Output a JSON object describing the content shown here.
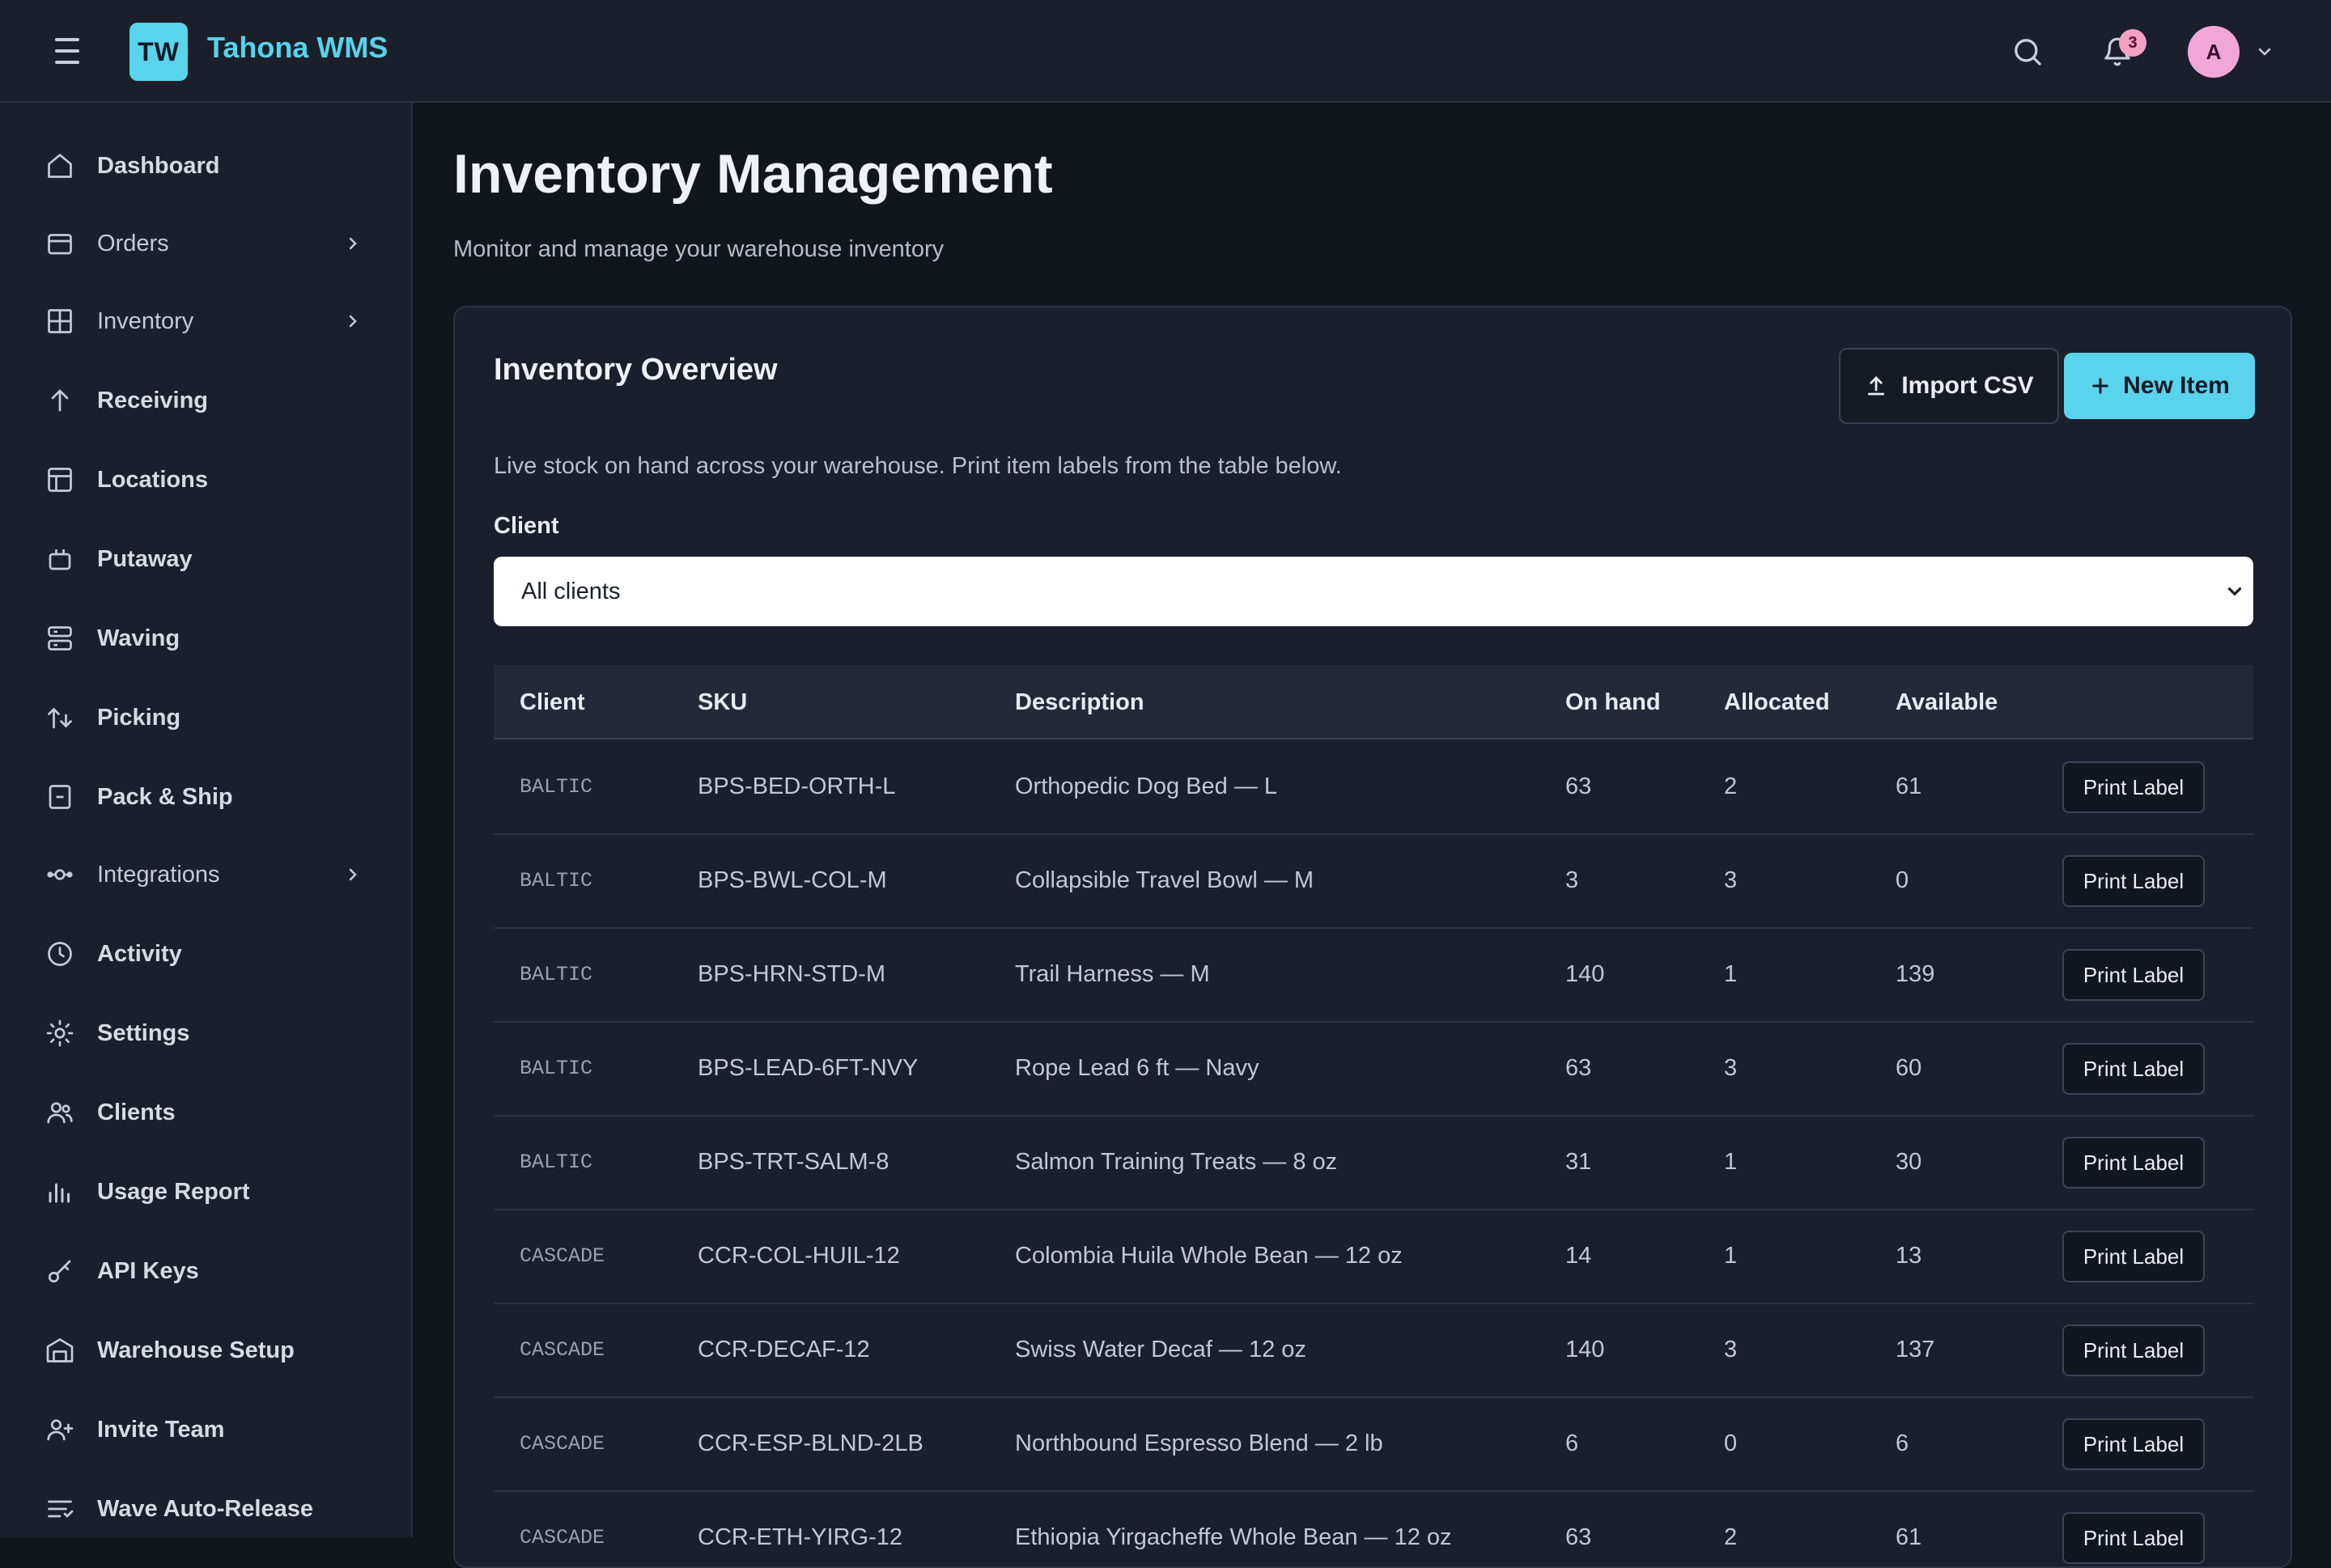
{
  "app": {
    "logo_initials": "TW",
    "name": "Tahona WMS",
    "notifications_count": "3",
    "avatar_initial": "A"
  },
  "icons": {
    "menu": "hamburger-icon",
    "search": "search-icon",
    "notifications": "bell-icon",
    "account_menu": "chevron-down-icon"
  },
  "colors": {
    "accent": "#57d3ea",
    "background": "#11151c",
    "surface": "#1a1f2b",
    "avatar": "#f0a6d9",
    "badge": "#f3a1c3"
  },
  "sidebar": {
    "items": [
      {
        "label": "Dashboard",
        "icon": "home-icon",
        "has_children": false
      },
      {
        "label": "Orders",
        "icon": "orders-icon",
        "has_children": true
      },
      {
        "label": "Inventory",
        "icon": "grid-icon",
        "has_children": true
      },
      {
        "label": "Receiving",
        "icon": "arrow-up-icon",
        "has_children": false
      },
      {
        "label": "Locations",
        "icon": "layout-icon",
        "has_children": false
      },
      {
        "label": "Putaway",
        "icon": "box-icon",
        "has_children": false
      },
      {
        "label": "Waving",
        "icon": "server-icon",
        "has_children": false
      },
      {
        "label": "Picking",
        "icon": "pick-icon",
        "has_children": false
      },
      {
        "label": "Pack & Ship",
        "icon": "package-icon",
        "has_children": false
      },
      {
        "label": "Integrations",
        "icon": "plug-icon",
        "has_children": true
      },
      {
        "label": "Activity",
        "icon": "clock-icon",
        "has_children": false
      },
      {
        "label": "Settings",
        "icon": "gear-icon",
        "has_children": false
      },
      {
        "label": "Clients",
        "icon": "users-icon",
        "has_children": false
      },
      {
        "label": "Usage Report",
        "icon": "bar-chart-icon",
        "has_children": false
      },
      {
        "label": "API Keys",
        "icon": "key-icon",
        "has_children": false
      },
      {
        "label": "Warehouse Setup",
        "icon": "warehouse-icon",
        "has_children": false
      },
      {
        "label": "Invite Team",
        "icon": "user-plus-icon",
        "has_children": false
      },
      {
        "label": "Wave Auto-Release",
        "icon": "list-filter-icon",
        "has_children": false
      }
    ]
  },
  "main": {
    "title": "Inventory Management",
    "subtitle": "Monitor and manage your warehouse inventory"
  },
  "card": {
    "title": "Inventory Overview",
    "import_label": "Import CSV",
    "new_label": "New Item",
    "description": "Live stock on hand across your warehouse. Print item labels from the table below.",
    "client_label": "Client",
    "client_selected": "All clients"
  },
  "table": {
    "headers": {
      "client": "Client",
      "sku": "SKU",
      "description": "Description",
      "on_hand": "On hand",
      "allocated": "Allocated",
      "available": "Available"
    },
    "action_label": "Print Label",
    "rows": [
      {
        "client": "BALTIC",
        "sku": "BPS-BED-ORTH-L",
        "description": "Orthopedic Dog Bed — L",
        "on_hand": "63",
        "allocated": "2",
        "available": "61"
      },
      {
        "client": "BALTIC",
        "sku": "BPS-BWL-COL-M",
        "description": "Collapsible Travel Bowl — M",
        "on_hand": "3",
        "allocated": "3",
        "available": "0"
      },
      {
        "client": "BALTIC",
        "sku": "BPS-HRN-STD-M",
        "description": "Trail Harness — M",
        "on_hand": "140",
        "allocated": "1",
        "available": "139"
      },
      {
        "client": "BALTIC",
        "sku": "BPS-LEAD-6FT-NVY",
        "description": "Rope Lead 6 ft — Navy",
        "on_hand": "63",
        "allocated": "3",
        "available": "60"
      },
      {
        "client": "BALTIC",
        "sku": "BPS-TRT-SALM-8",
        "description": "Salmon Training Treats — 8 oz",
        "on_hand": "31",
        "allocated": "1",
        "available": "30"
      },
      {
        "client": "CASCADE",
        "sku": "CCR-COL-HUIL-12",
        "description": "Colombia Huila Whole Bean — 12 oz",
        "on_hand": "14",
        "allocated": "1",
        "available": "13"
      },
      {
        "client": "CASCADE",
        "sku": "CCR-DECAF-12",
        "description": "Swiss Water Decaf — 12 oz",
        "on_hand": "140",
        "allocated": "3",
        "available": "137"
      },
      {
        "client": "CASCADE",
        "sku": "CCR-ESP-BLND-2LB",
        "description": "Northbound Espresso Blend — 2 lb",
        "on_hand": "6",
        "allocated": "0",
        "available": "6"
      },
      {
        "client": "CASCADE",
        "sku": "CCR-ETH-YIRG-12",
        "description": "Ethiopia Yirgacheffe Whole Bean — 12 oz",
        "on_hand": "63",
        "allocated": "2",
        "available": "61"
      }
    ]
  }
}
